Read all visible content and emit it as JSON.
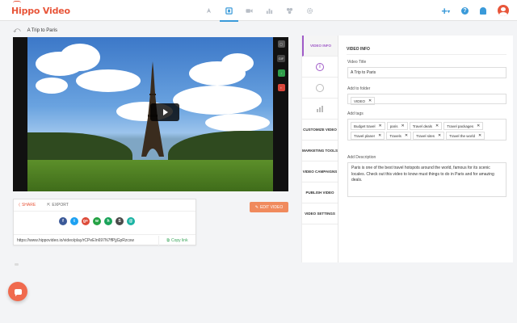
{
  "app": {
    "logo_text": "Hippo Video"
  },
  "nav": {
    "items": [
      {
        "name": "rocket-icon",
        "active": false
      },
      {
        "name": "video-library-icon",
        "active": true
      },
      {
        "name": "record-icon",
        "active": false
      },
      {
        "name": "analytics-icon",
        "active": false
      },
      {
        "name": "integrations-icon",
        "active": false
      },
      {
        "name": "gear-icon",
        "active": false
      }
    ]
  },
  "header_right": {
    "plus_label": "+",
    "help_label": "?"
  },
  "breadcrumb": {
    "title": "A Trip to Paris"
  },
  "video_tools": {
    "gif_label": "GIF"
  },
  "share": {
    "tab_share": "SHARE",
    "tab_export": "EXPORT",
    "socials": [
      {
        "name": "facebook-icon",
        "glyph": "f",
        "color": "#3b5998"
      },
      {
        "name": "twitter-icon",
        "glyph": "t",
        "color": "#1da1f2"
      },
      {
        "name": "google-plus-icon",
        "glyph": "g+",
        "color": "#dd4b39"
      },
      {
        "name": "whatsapp-icon",
        "glyph": "w",
        "color": "#25a244"
      },
      {
        "name": "hangouts-icon",
        "glyph": "h",
        "color": "#1aa35a"
      },
      {
        "name": "skype-icon",
        "glyph": "S",
        "color": "#4a4a4a"
      },
      {
        "name": "email-icon",
        "glyph": "@",
        "color": "#1bb3a3"
      }
    ],
    "link": "https://www.hippovideo.io/video/play/rCPeEIn697N7ffPjjGpRzcsw",
    "copy_label": "Copy link"
  },
  "edit_button": {
    "label": "EDIT VIDEO"
  },
  "side_tabs": {
    "video_info": "VIDEO INFO",
    "customize": "CUSTOMIZE VIDEO",
    "marketing": "MARKETING TOOLS",
    "campaigns": "VIDEO CAMPAIGNS",
    "publish": "PUBLISH VIDEO",
    "settings": "VIDEO SETTINGS"
  },
  "video_info": {
    "heading": "VIDEO INFO",
    "title_label": "Video Title",
    "title_value": "A Trip to Paris",
    "folder_label": "Add to folder",
    "folder_value": "VIDEO",
    "tags_label": "Add tags",
    "tags": [
      "Budget travel",
      "paris",
      "Travel deals",
      "Travel packages",
      "Travel planer",
      "Travels",
      "Travel sites",
      "Travel the world"
    ],
    "description_label": "Add Description",
    "description_value": "Paris is one of the best travel hotspots around the world, famous for its scenic locales. Check out this video to know must things to do in Paris and for amazing deals."
  }
}
